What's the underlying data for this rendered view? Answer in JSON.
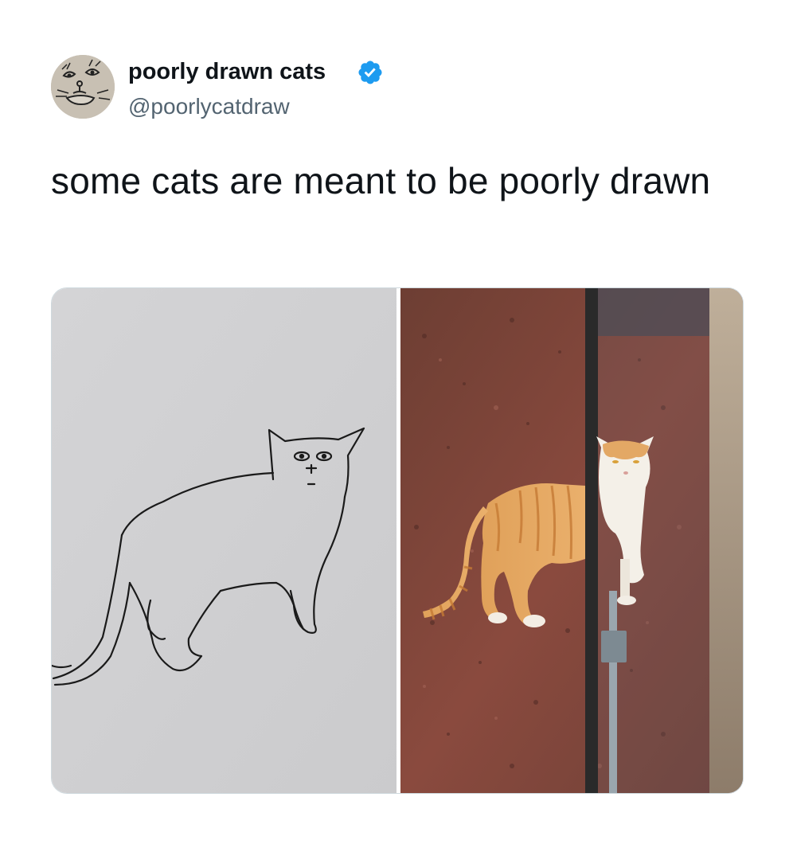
{
  "tweet": {
    "author": {
      "display_name": "poorly drawn cats",
      "handle": "@poorlycatdraw",
      "verified": true,
      "verified_badge_color": "#1d9bf0",
      "avatar_icon": "poorly-drawn-cat-face"
    },
    "text": "some cats are meant to be poorly drawn",
    "media": [
      {
        "kind": "drawing",
        "subject": "line drawing of a cat on gray paper"
      },
      {
        "kind": "photo",
        "subject": "orange and white cat half hidden behind a glass panel on red granite floor"
      }
    ]
  }
}
